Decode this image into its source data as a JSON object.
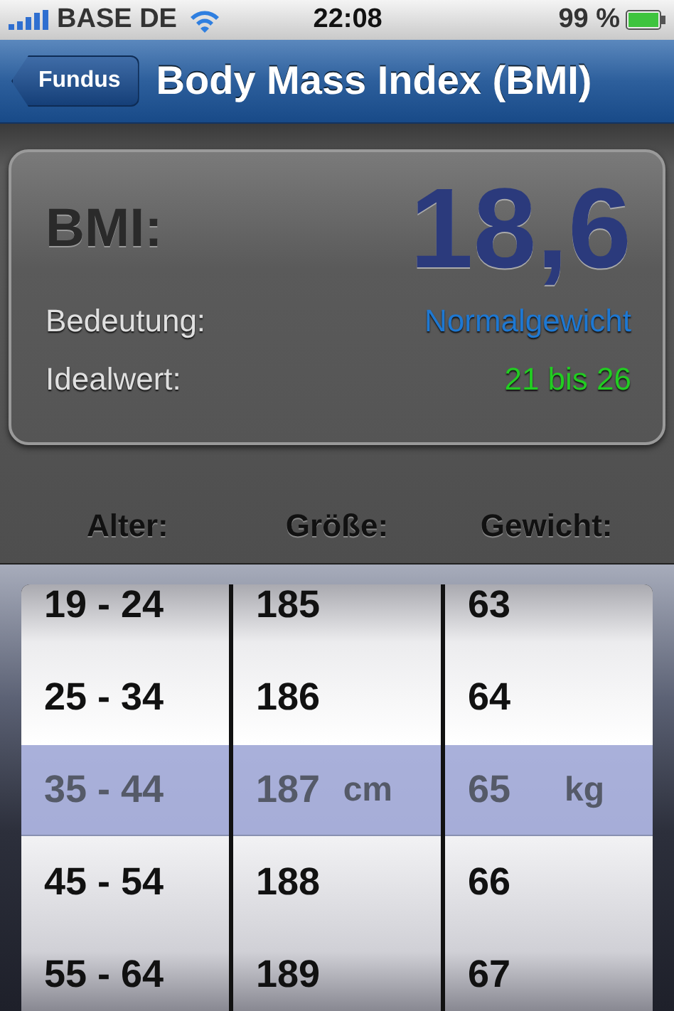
{
  "status_bar": {
    "carrier": "BASE DE",
    "time": "22:08",
    "battery": "99 %"
  },
  "nav_bar": {
    "back": "Fundus",
    "title": "Body Mass Index (BMI)"
  },
  "result": {
    "label": "BMI:",
    "value": "18,6",
    "rows": [
      {
        "label": "Bedeutung:",
        "value": "Normalgewicht",
        "color": "#1e78d2"
      },
      {
        "label": "Idealwert:",
        "value": "21 bis 26",
        "color": "#22cc22"
      }
    ]
  },
  "picker": {
    "columns": [
      {
        "header": "Alter:",
        "rows": [
          {
            "label": "19 - 24",
            "selected": false
          },
          {
            "label": "25 - 34",
            "selected": false
          },
          {
            "label": "35 - 44",
            "selected": true
          },
          {
            "label": "45 - 54",
            "selected": false
          },
          {
            "label": "55 - 64",
            "selected": false
          }
        ]
      },
      {
        "header": "Größe:",
        "unit": "cm",
        "rows": [
          {
            "label": "185",
            "selected": false
          },
          {
            "label": "186",
            "selected": false
          },
          {
            "label": "187",
            "selected": true
          },
          {
            "label": "188",
            "selected": false
          },
          {
            "label": "189",
            "selected": false
          }
        ]
      },
      {
        "header": "Gewicht:",
        "unit": "kg",
        "rows": [
          {
            "label": "63",
            "selected": false
          },
          {
            "label": "64",
            "selected": false
          },
          {
            "label": "65",
            "selected": true
          },
          {
            "label": "66",
            "selected": false
          },
          {
            "label": "67",
            "selected": false
          }
        ]
      }
    ]
  }
}
